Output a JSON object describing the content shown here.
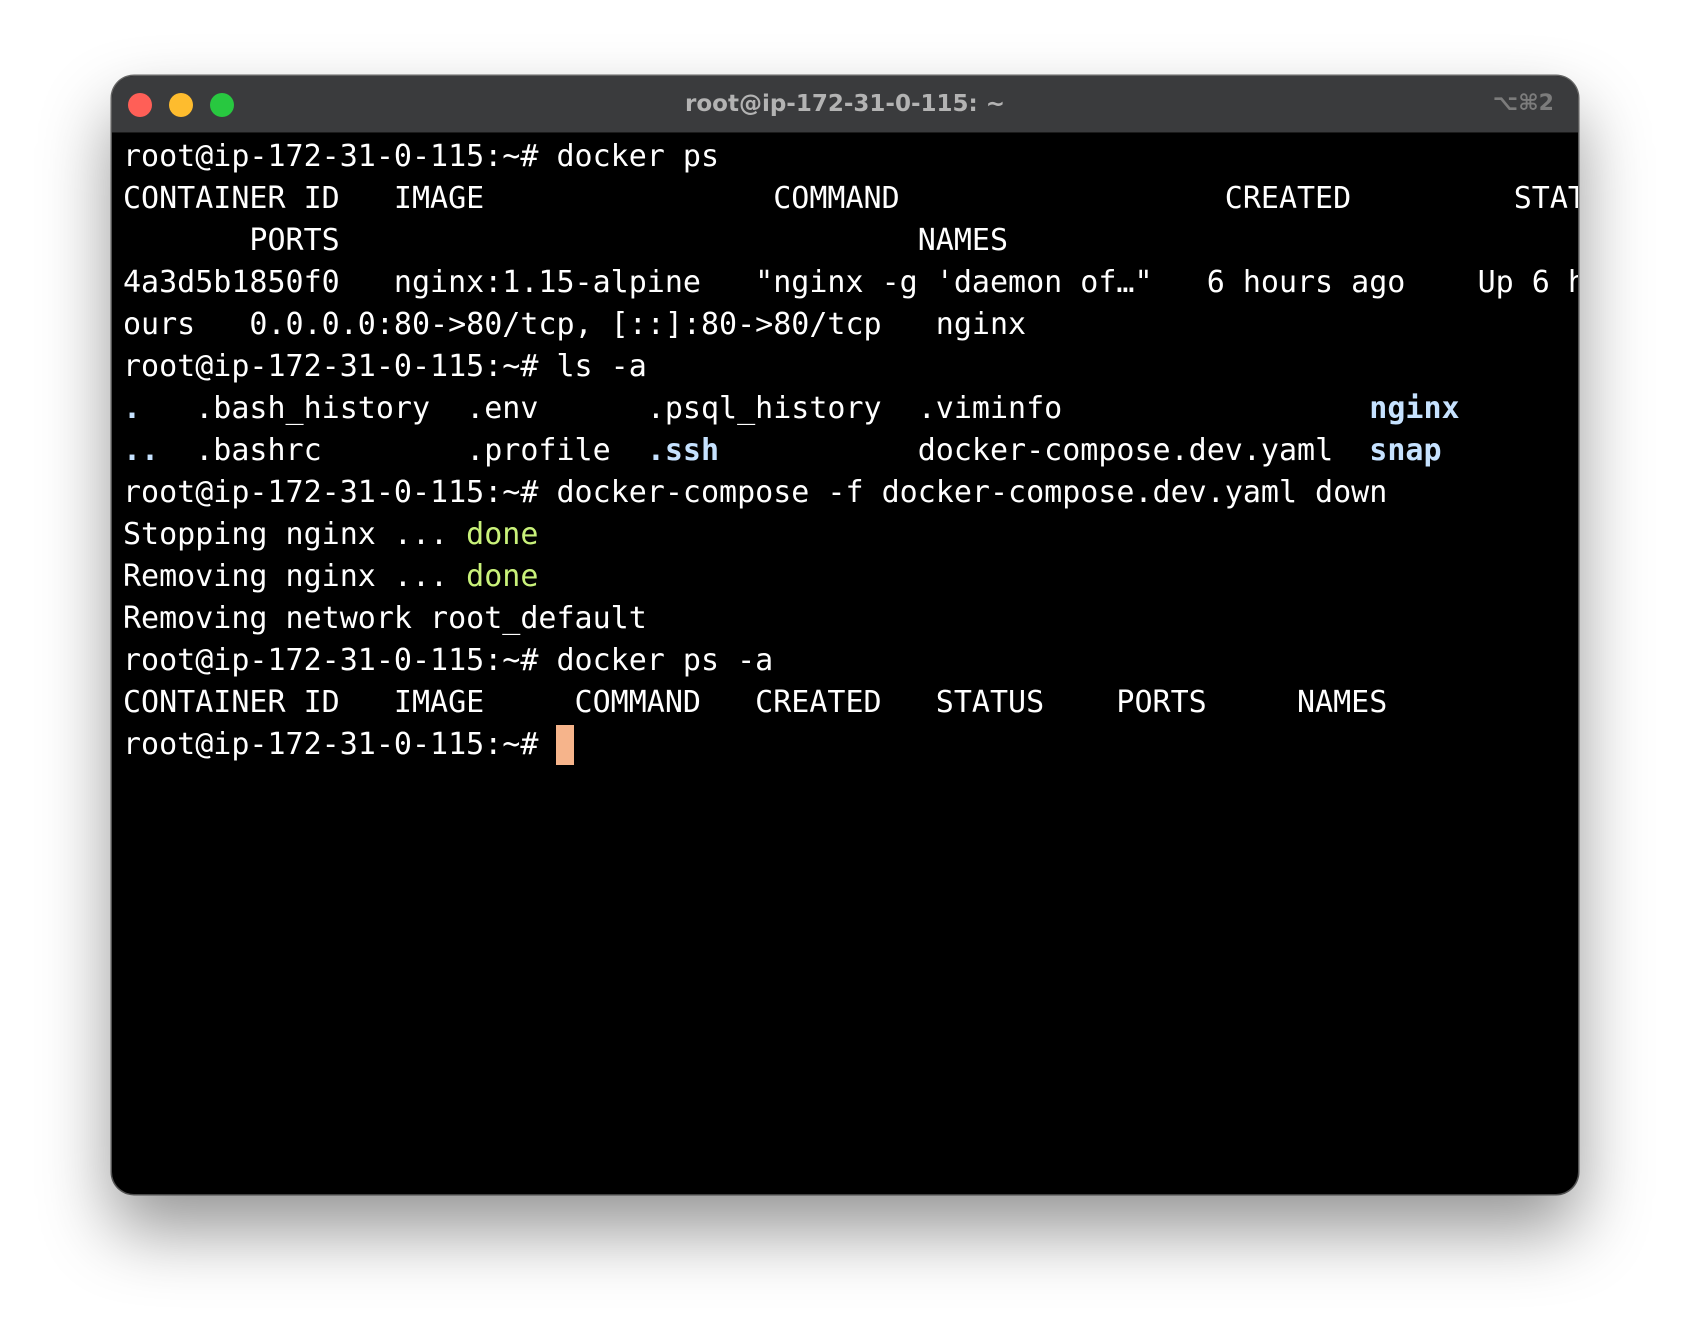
{
  "window": {
    "title": "root@ip-172-31-0-115: ~",
    "shortcut": "⌥⌘2"
  },
  "terminal": {
    "lines": [
      "root@ip-172-31-0-115:~# docker ps",
      "CONTAINER ID   IMAGE                COMMAND                  CREATED         STATUS",
      "       PORTS                                NAMES",
      "4a3d5b1850f0   nginx:1.15-alpine   \"nginx -g 'daemon of…\"   6 hours ago    Up 6 h",
      "ours   0.0.0.0:80->80/tcp, [::]:80->80/tcp   nginx",
      "root@ip-172-31-0-115:~# ls -a"
    ],
    "ls_row1": {
      "c1": ".   ",
      "c2": ".bash_history  ",
      "c3": ".env      ",
      "c4": ".psql_history  ",
      "c5": ".viminfo                 ",
      "c6": "nginx"
    },
    "ls_row2": {
      "c1": "..  ",
      "c2": ".bashrc        ",
      "c3": ".profile  ",
      "c4": ".ssh           ",
      "c5": "docker-compose.dev.yaml  ",
      "c6": "snap"
    },
    "compose_cmd": "root@ip-172-31-0-115:~# docker-compose -f docker-compose.dev.yaml down",
    "stopping_prefix": "Stopping nginx ... ",
    "stopping_status": "done",
    "removing_prefix": "Removing nginx ... ",
    "removing_status": "done",
    "removing_network": "Removing network root_default",
    "ps_a_cmd": "root@ip-172-31-0-115:~# docker ps -a",
    "ps_a_header": "CONTAINER ID   IMAGE     COMMAND   CREATED   STATUS    PORTS     NAMES",
    "prompt": "root@ip-172-31-0-115:~# "
  },
  "colors": {
    "directory": "#c6e2ff",
    "success": "#c9f27a",
    "cursor": "#f6b48b",
    "titlebar": "#3a3b3d",
    "background": "#000000"
  }
}
